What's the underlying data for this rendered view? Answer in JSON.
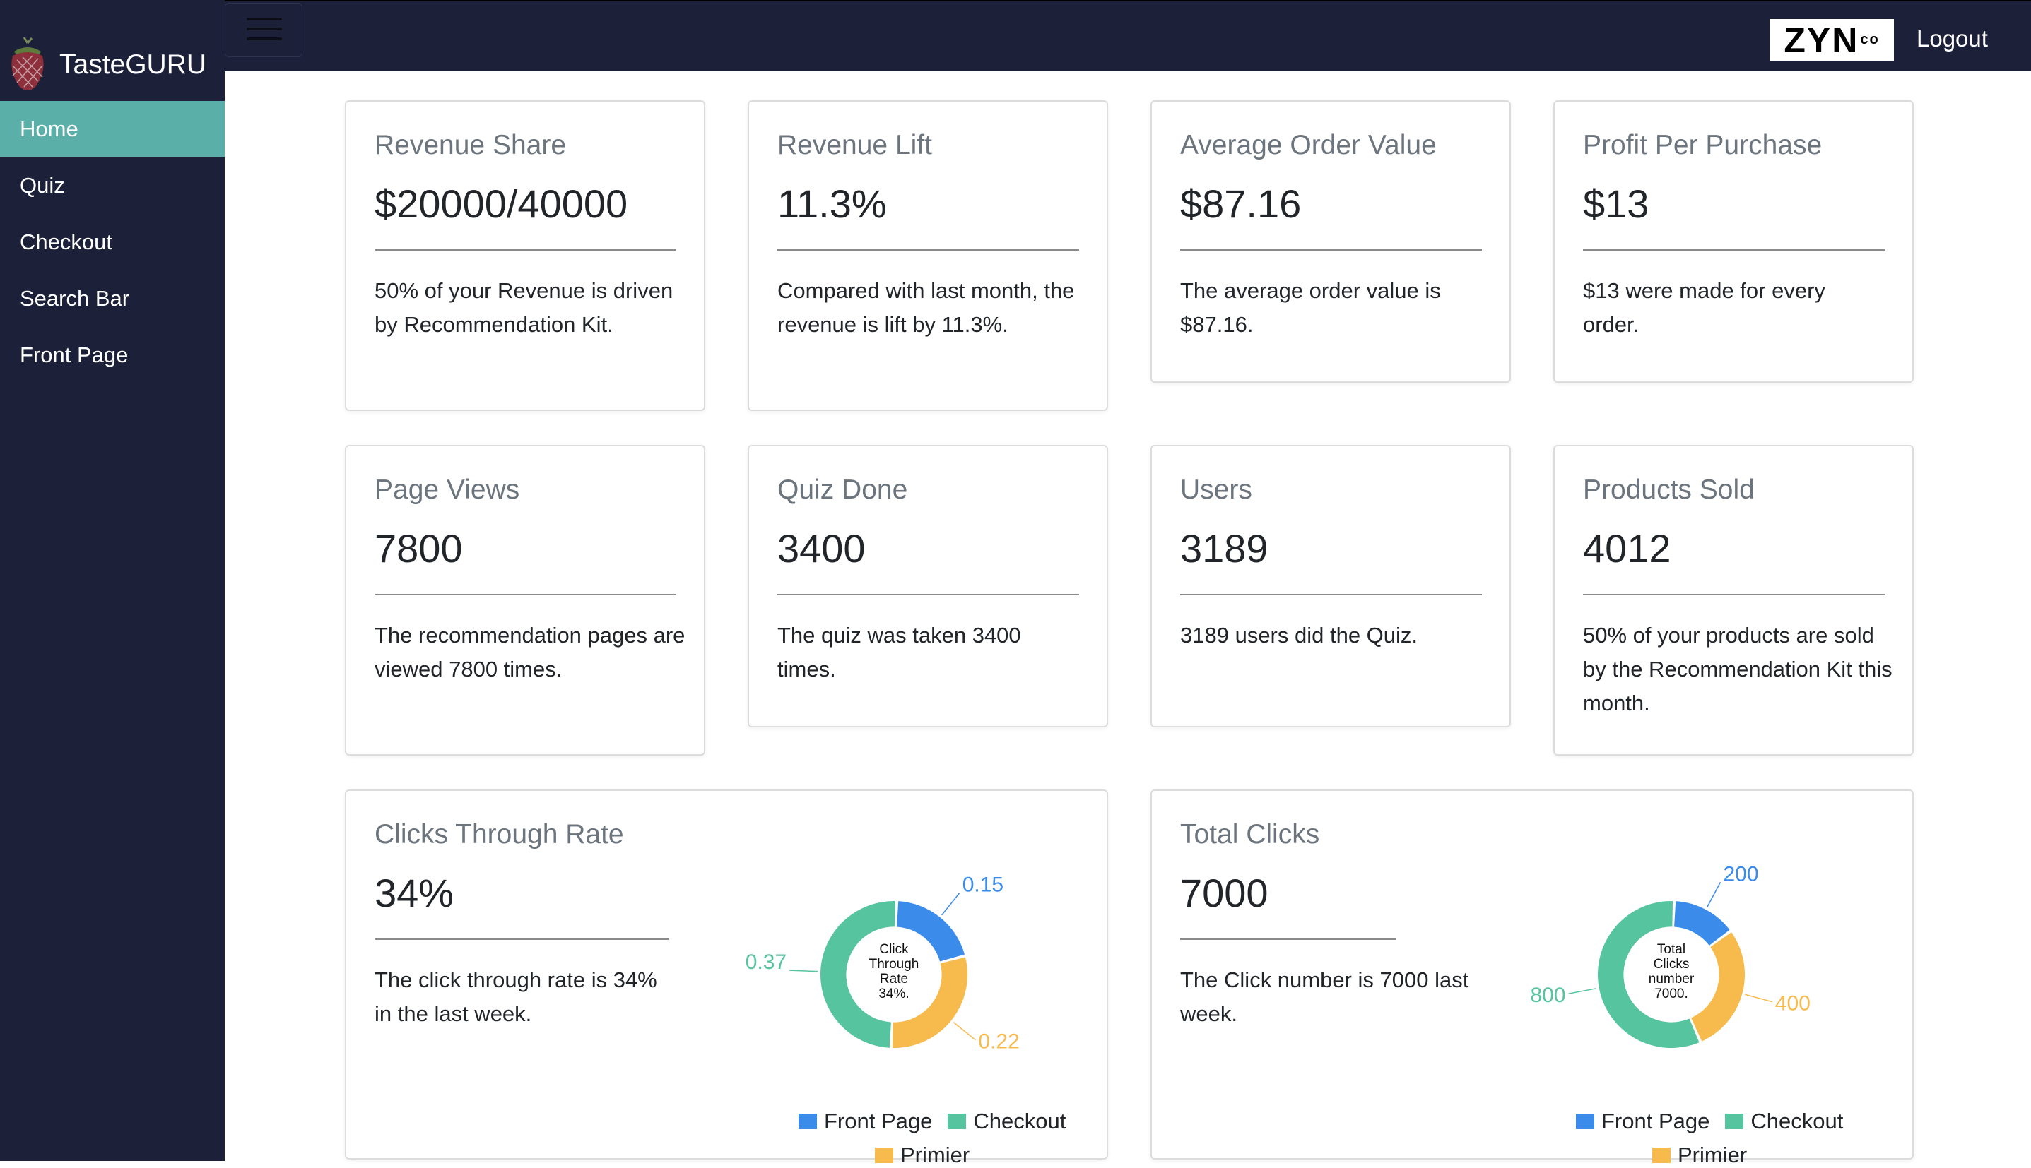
{
  "app": {
    "name": "TasteGURU"
  },
  "header": {
    "partner_logo": "ZYN",
    "partner_logo_sup": "co",
    "logout_label": "Logout"
  },
  "sidebar": {
    "items": [
      {
        "label": "Home",
        "active": true
      },
      {
        "label": "Quiz"
      },
      {
        "label": "Checkout"
      },
      {
        "label": "Search Bar"
      },
      {
        "label": "Front Page"
      }
    ]
  },
  "cards": [
    {
      "title": "Revenue Share",
      "value": "$20000/40000",
      "desc": "50% of your Revenue is driven by Recommendation Kit."
    },
    {
      "title": "Revenue Lift",
      "value": "11.3%",
      "desc": "Compared with last month, the revenue is lift by 11.3%."
    },
    {
      "title": "Average Order Value",
      "value": "$87.16",
      "desc": "The average order value is $87.16."
    },
    {
      "title": "Profit Per Purchase",
      "value": "$13",
      "desc": "$13 were made for every order."
    },
    {
      "title": "Page Views",
      "value": "7800",
      "desc": "The recommendation pages are viewed 7800 times."
    },
    {
      "title": "Quiz Done",
      "value": "3400",
      "desc": "The quiz was taken 3400 times."
    },
    {
      "title": "Users",
      "value": "3189",
      "desc": "3189 users did the Quiz."
    },
    {
      "title": "Products Sold",
      "value": "4012",
      "desc": "50% of your products are sold by the Recommendation Kit this month."
    }
  ],
  "charts_cards": [
    {
      "title": "Clicks Through Rate",
      "value": "34%",
      "desc": "The click through rate is 34% in the last week."
    },
    {
      "title": "Total Clicks",
      "value": "7000",
      "desc": "The Click number is 7000 last week."
    }
  ],
  "chart_data": [
    {
      "type": "pie",
      "variant": "doughnut",
      "center_text": "Click Through Rate 34%.",
      "categories": [
        "Front Page",
        "Checkout",
        "Primier"
      ],
      "values": [
        0.15,
        0.37,
        0.22
      ],
      "value_labels": [
        "0.15",
        "0.37",
        "0.22"
      ],
      "colors": [
        "#3b8beb",
        "#56c49f",
        "#f7bb4d"
      ],
      "legend": "bottom"
    },
    {
      "type": "pie",
      "variant": "doughnut",
      "center_text": "Total Clicks number 7000.",
      "categories": [
        "Front Page",
        "Checkout",
        "Primier"
      ],
      "values": [
        200,
        800,
        400
      ],
      "value_labels": [
        "200",
        "800",
        "400"
      ],
      "colors": [
        "#3b8beb",
        "#56c49f",
        "#f7bb4d"
      ],
      "legend": "bottom"
    }
  ]
}
